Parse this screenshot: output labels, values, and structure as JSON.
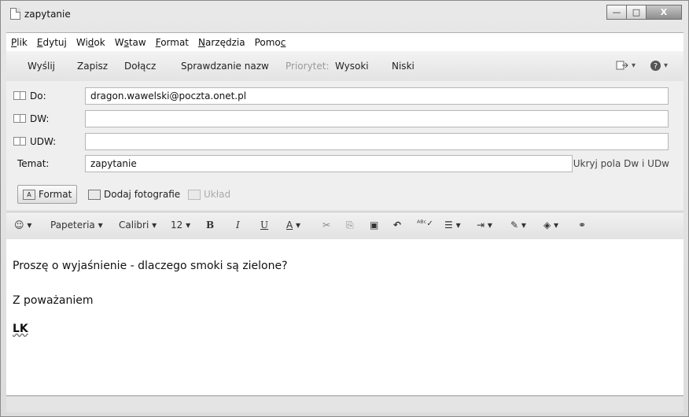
{
  "window": {
    "title": "zapytanie",
    "controls": {
      "minimize": "—",
      "maximize": "□",
      "close": "X"
    }
  },
  "menu": [
    {
      "pre": "",
      "u": "P",
      "post": "lik"
    },
    {
      "pre": "",
      "u": "E",
      "post": "dytuj"
    },
    {
      "pre": "Wi",
      "u": "d",
      "post": "ok"
    },
    {
      "pre": "W",
      "u": "s",
      "post": "taw"
    },
    {
      "pre": "",
      "u": "F",
      "post": "ormat"
    },
    {
      "pre": "",
      "u": "N",
      "post": "arzędzia"
    },
    {
      "pre": "Pomo",
      "u": "c",
      "post": ""
    }
  ],
  "toolbar": {
    "send": "Wyślij",
    "save": "Zapisz",
    "attach": "Dołącz",
    "check_names": "Sprawdzanie nazw",
    "priority": "Priorytet:",
    "high": "Wysoki",
    "low": "Niski",
    "icons": {
      "send_receive": "send-receive-icon",
      "help": "help-icon"
    },
    "dropdown": "▾"
  },
  "headers": {
    "to_label": "Do:",
    "to_value": "dragon.wawelski@poczta.onet.pl",
    "cc_label": "DW:",
    "cc_value": "",
    "bcc_label": "UDW:",
    "bcc_value": "",
    "subject_label": "Temat:",
    "subject_value": "zapytanie",
    "hide_link": "Ukryj pola Dw i UDw"
  },
  "format_row": {
    "format": "Format",
    "add_photos": "Dodaj fotografie",
    "layout": "Układ"
  },
  "formatbar": {
    "stationery": "Papeteria",
    "font": "Calibri",
    "size": "12",
    "bold": "B",
    "italic": "I",
    "underline": "U",
    "font_color": "A"
  },
  "body": {
    "line1": "Proszę o wyjaśnienie - dlaczego smoki są zielone?",
    "line2": "Z poważaniem",
    "signature": "LK"
  }
}
